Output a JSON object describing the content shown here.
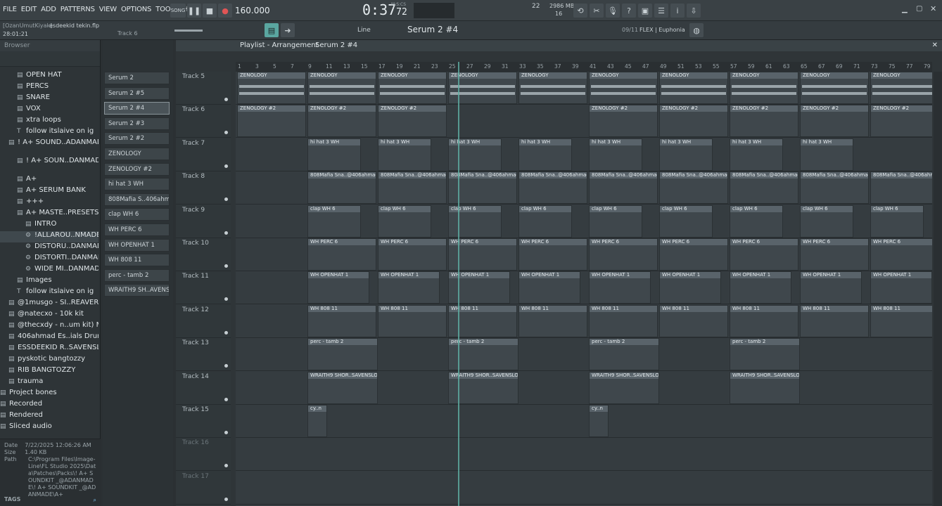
{
  "menu": [
    "FILE",
    "EDIT",
    "ADD",
    "PATTERNS",
    "VIEW",
    "OPTIONS",
    "TOOLS",
    "HELP"
  ],
  "transport": {
    "mode": "SONG",
    "tempo": "160.000",
    "time": "0:37",
    "time_sub": "72",
    "time_label": "M:S:CS",
    "cpu_label": "2986 MB",
    "poly": "16",
    "step": "22"
  },
  "project": {
    "user": "[OzanUmutKiyak]",
    "file": "esdeekid tekin.flp",
    "duration": "28:01:21",
    "hint": "Track 6"
  },
  "toolbar2": {
    "snap": "Line",
    "pattern": "Serum 2 #4",
    "plugin_info": "09/11",
    "plugin_name": "FLEX | Euphonia"
  },
  "browser": {
    "title": "Browser",
    "items": [
      {
        "label": "OPEN HAT",
        "icon": "folder-icon"
      },
      {
        "label": "PERCS",
        "icon": "folder-icon"
      },
      {
        "label": "SNARE",
        "icon": "folder-icon"
      },
      {
        "label": "VOX",
        "icon": "folder-icon"
      },
      {
        "label": "xtra loops",
        "icon": "folder-icon"
      },
      {
        "label": "follow itslaive on ig",
        "icon": "text-icon"
      },
      {
        "label": "! A+ SOUND..ADANMADE",
        "icon": "folder-icon"
      },
      {
        "label": "! A+ SOUN..DANMADE",
        "icon": "folder-icon"
      },
      {
        "label": "A+",
        "icon": "folder-icon"
      },
      {
        "label": "A+ SERUM BANK",
        "icon": "folder-icon"
      },
      {
        "label": "+++",
        "icon": "folder-icon"
      },
      {
        "label": "A+ MASTE..PRESETS",
        "icon": "folder-icon"
      },
      {
        "label": "INTRO",
        "icon": "folder-icon"
      },
      {
        "label": "!ALLAROU..NMADE",
        "icon": "preset-icon"
      },
      {
        "label": "DISTORU..DANMADE",
        "icon": "preset-icon"
      },
      {
        "label": "DISTORTI..DANMADE",
        "icon": "preset-icon"
      },
      {
        "label": "WIDE MI..DANMADE",
        "icon": "preset-icon"
      },
      {
        "label": "Images",
        "icon": "folder-icon"
      },
      {
        "label": "follow itslaive on ig",
        "icon": "text-icon"
      },
      {
        "label": "@1musgo - SI..REAVER KIT",
        "icon": "folder-icon"
      },
      {
        "label": "@natecxo - 10k kit",
        "icon": "folder-icon"
      },
      {
        "label": "@thecxdy - n..um kit) MAC",
        "icon": "folder-icon"
      },
      {
        "label": "406ahmad Es..ials Drumkit",
        "icon": "folder-icon"
      },
      {
        "label": "ESSDEEKID R..SAVENSLORE",
        "icon": "folder-icon"
      },
      {
        "label": "pyskotic bangtozzy",
        "icon": "folder-icon"
      },
      {
        "label": "RIB BANGTOZZY",
        "icon": "folder-icon"
      },
      {
        "label": "trauma",
        "icon": "folder-icon"
      },
      {
        "label": "Project bones",
        "icon": "folder-icon"
      },
      {
        "label": "Recorded",
        "icon": "folder-icon"
      },
      {
        "label": "Rendered",
        "icon": "folder-icon"
      },
      {
        "label": "Sliced audio",
        "icon": "folder-icon"
      }
    ],
    "info": {
      "date_label": "Date",
      "date": "7/22/2025 12:06:26 AM",
      "size_label": "Size",
      "size": "1.40 KB",
      "path_label": "Path",
      "path": "C:\\Program Files\\Image-Line\\FL Studio 2025\\Data\\Patches\\Packs\\! A+ SOUNDKIT _@ADANMADE\\! A+ SOUNDKIT _@ADANMADE\\A+"
    },
    "tags": "TAGS"
  },
  "patterns": [
    "Serum 2",
    "Serum 2 #5",
    "Serum 2 #4",
    "Serum 2 #3",
    "Serum 2 #2",
    "ZENOLOGY",
    "ZENOLOGY #2",
    "hi hat 3 WH",
    "808Mafia S..406ahmad",
    "clap WH 6",
    "WH PERC 6",
    "WH OPENHAT 1",
    "WH 808 11",
    "perc - tamb 2",
    "WRAITH9 SH..AVENSLORE"
  ],
  "playlist": {
    "title": "Playlist - Arrangement",
    "pattern": "Serum 2 #4"
  },
  "ruler": [
    "1",
    "3",
    "5",
    "7",
    "9",
    "11",
    "13",
    "15",
    "17",
    "19",
    "21",
    "23",
    "25",
    "27",
    "29",
    "31",
    "33",
    "35",
    "37",
    "39",
    "41",
    "43",
    "45",
    "47",
    "49",
    "51",
    "53",
    "55",
    "57",
    "59",
    "61",
    "63",
    "65",
    "67",
    "69",
    "71",
    "73",
    "75",
    "77",
    "79"
  ],
  "tracks": [
    {
      "name": "Track 5",
      "clip": "ZENOLOGY",
      "starts": [
        0,
        100,
        200,
        300,
        400,
        500,
        600,
        700,
        800,
        900
      ],
      "len": 98
    },
    {
      "name": "Track 6",
      "clip": "ZENOLOGY #2",
      "starts": [
        0,
        100,
        200,
        500,
        600,
        700,
        800,
        900
      ],
      "len": 98
    },
    {
      "name": "Track 7",
      "clip": "hi hat 3 WH",
      "starts": [
        100,
        200,
        300,
        400,
        500,
        600,
        700,
        800
      ],
      "len": 76
    },
    {
      "name": "Track 8",
      "clip": "808Mafia Sna..@406ahmad_",
      "starts": [
        100,
        200,
        300,
        400,
        500,
        600,
        700,
        800,
        900
      ],
      "len": 98
    },
    {
      "name": "Track 9",
      "clip": "clap WH 6",
      "starts": [
        100,
        200,
        300,
        400,
        500,
        600,
        700,
        800,
        900
      ],
      "len": 76
    },
    {
      "name": "Track 10",
      "clip": "WH PERC 6",
      "starts": [
        100,
        200,
        300,
        400,
        500,
        600,
        700,
        800,
        900
      ],
      "len": 98
    },
    {
      "name": "Track 11",
      "clip": "WH OPENHAT 1",
      "starts": [
        100,
        200,
        300,
        400,
        500,
        600,
        700,
        800,
        900
      ],
      "len": 88
    },
    {
      "name": "Track 12",
      "clip": "WH 808 11",
      "starts": [
        100,
        200,
        300,
        400,
        500,
        600,
        700,
        800,
        900
      ],
      "len": 98
    },
    {
      "name": "Track 13",
      "clip": "perc - tamb 2",
      "starts": [
        100,
        300,
        500,
        700
      ],
      "len": 100
    },
    {
      "name": "Track 14",
      "clip": "WRAITH9 SHOR..SAVENSLORE",
      "starts": [
        100,
        300,
        500,
        700
      ],
      "len": 100
    },
    {
      "name": "Track 15",
      "clip": "cy..n",
      "starts": [
        100,
        500
      ],
      "len": 28
    },
    {
      "name": "Track 16",
      "clip": "",
      "starts": [],
      "len": 0
    },
    {
      "name": "Track 17",
      "clip": "",
      "starts": [],
      "len": 0
    }
  ]
}
